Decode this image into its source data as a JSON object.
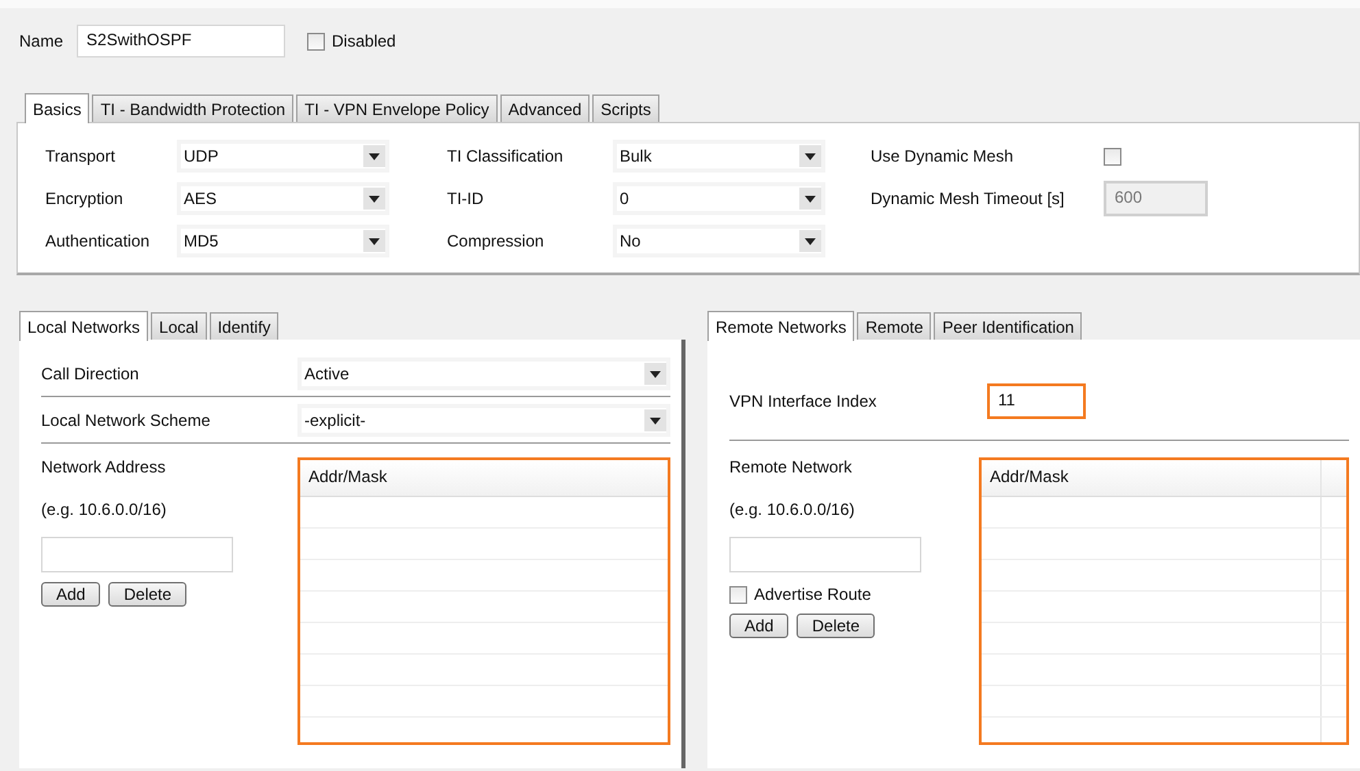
{
  "name_field": {
    "label": "Name",
    "value": "S2SwithOSPF"
  },
  "disabled": {
    "label": "Disabled",
    "checked": false
  },
  "tabs": [
    {
      "label": "Basics",
      "selected": true
    },
    {
      "label": "TI - Bandwidth Protection",
      "selected": false
    },
    {
      "label": "TI - VPN Envelope Policy",
      "selected": false
    },
    {
      "label": "Advanced",
      "selected": false
    },
    {
      "label": "Scripts",
      "selected": false
    }
  ],
  "basics": [
    [
      {
        "kind": "select",
        "label": "Transport",
        "value": "UDP"
      },
      {
        "kind": "select",
        "label": "Encryption",
        "value": "AES"
      },
      {
        "kind": "select",
        "label": "Authentication",
        "value": "MD5"
      }
    ],
    [
      {
        "kind": "select",
        "label": "TI Classification",
        "value": "Bulk"
      },
      {
        "kind": "select",
        "label": "TI-ID",
        "value": "0"
      },
      {
        "kind": "select",
        "label": "Compression",
        "value": "No"
      }
    ],
    [
      {
        "kind": "checkbox",
        "label": "Use Dynamic Mesh",
        "checked": false
      },
      {
        "kind": "input",
        "label": "Dynamic Mesh Timeout [s]",
        "value": "600",
        "disabled": true
      }
    ]
  ],
  "panels": [
    {
      "tabs": [
        {
          "label": "Local Networks",
          "selected": true
        },
        {
          "label": "Local",
          "selected": false
        },
        {
          "label": "Identify",
          "selected": false
        }
      ],
      "rows": [
        {
          "kind": "select",
          "label": "Call Direction",
          "value": "Active"
        },
        {
          "kind": "select",
          "label": "Local Network Scheme",
          "value": "-explicit-"
        }
      ],
      "network_label": "Network Address",
      "hint": "(e.g. 10.6.0.0/16)",
      "buttons": [
        "Add",
        "Delete"
      ],
      "table": {
        "column": "Addr/Mask",
        "highlighted": true
      }
    },
    {
      "tabs": [
        {
          "label": "Remote Networks",
          "selected": true
        },
        {
          "label": "Remote",
          "selected": false
        },
        {
          "label": "Peer Identification",
          "selected": false
        }
      ],
      "rows": [
        {
          "kind": "input",
          "label": "VPN Interface Index",
          "value": "11",
          "highlighted": true
        }
      ],
      "network_label": "Remote Network",
      "hint": "(e.g. 10.6.0.0/16)",
      "advertise": {
        "label": "Advertise Route",
        "checked": false
      },
      "buttons": [
        "Add",
        "Delete"
      ],
      "table": {
        "column": "Addr/Mask",
        "highlighted": true,
        "extra_column": true
      }
    }
  ]
}
